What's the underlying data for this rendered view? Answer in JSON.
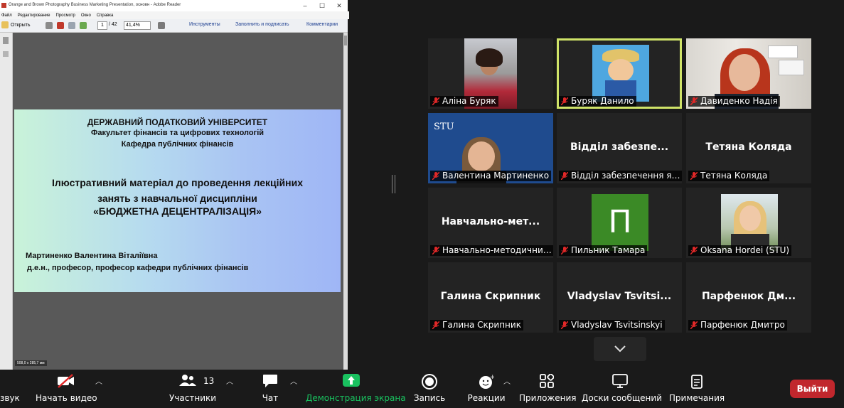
{
  "reader": {
    "window_title": "Orange and Brown Photography Business Marketing Presentation, основн - Adobe Reader",
    "menu": [
      "Файл",
      "Редактирование",
      "Просмотр",
      "Окно",
      "Справка"
    ],
    "toolbar": {
      "open_label": "Открыть",
      "page_current": "1",
      "page_total": "/ 42",
      "zoom": "41,4%",
      "tools_label": "Инструменты",
      "fill_sign_label": "Заполнить и подписать",
      "comments_label": "Комментарии"
    },
    "slide": {
      "line1": "ДЕРЖАВНИЙ ПОДАТКОВИЙ УНІВЕРСИТЕТ",
      "line2": "Факультет фінансів та цифрових технологій",
      "line3": "Кафедра публічних фінансів",
      "title1": "Ілюстративний матеріал до проведення лекційних",
      "title2": "занять з навчальної дисципліни",
      "title3": "«БЮДЖЕТНА ДЕЦЕНТРАЛІЗАЦІЯ»",
      "author": "Мартиненко Валентина Віталіївна",
      "author_role": "д.е.н., професор, професор кафедри публічних фінансів"
    },
    "page_size": "508,0 x 285,7 мм"
  },
  "gallery": {
    "tiles": [
      {
        "label": "Аліна Буряк",
        "big": ""
      },
      {
        "label": "Буряк Данило",
        "big": ""
      },
      {
        "label": "Давиденко Надія",
        "big": ""
      },
      {
        "label": "Валентина Мартиненко",
        "big": ""
      },
      {
        "label": "Відділ забезпечення як...",
        "big": "Відділ  забезпе..."
      },
      {
        "label": "Тетяна Коляда",
        "big": "Тетяна Коляда"
      },
      {
        "label": "Навчально-методичний...",
        "big": "Навчально-мет..."
      },
      {
        "label": "Пильник Тамара",
        "big": ""
      },
      {
        "label": "Oksana Hordei (STU)",
        "big": ""
      },
      {
        "label": "Галина Скрипник",
        "big": "Галина Скрипник"
      },
      {
        "label": "Vladyslav Tsvitsinskyi",
        "big": "Vladyslav  Tsvitsi..."
      },
      {
        "label": "Парфенюк Дмитро",
        "big": "Парфенюк  Дм..."
      }
    ],
    "avatar_letter": "П",
    "stu_logo_text": "STU"
  },
  "controls": {
    "audio_label": "звук",
    "video_label": "Начать видео",
    "participants_label": "Участники",
    "participants_count": "13",
    "chat_label": "Чат",
    "share_label": "Демонстрация экрана",
    "record_label": "Запись",
    "reactions_label": "Реакции",
    "apps_label": "Приложения",
    "whiteboards_label": "Доски сообщений",
    "notes_label": "Примечания",
    "leave_label": "Выйти"
  },
  "colors": {
    "share_green": "#19c15f",
    "active_speaker": "#cfe368",
    "leave_red": "#c1272d",
    "avatar_green": "#3b8a26"
  }
}
